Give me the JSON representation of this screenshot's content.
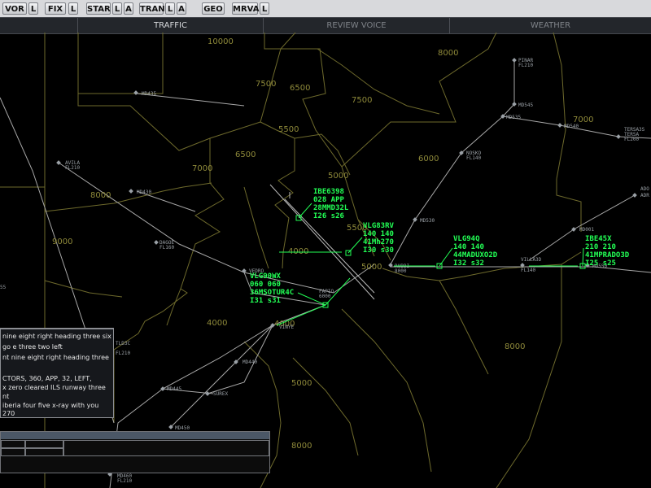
{
  "toolbar": {
    "buttons": [
      {
        "label": "VOR",
        "toggles": [
          "L"
        ]
      },
      {
        "label": "FIX",
        "toggles": [
          "L"
        ]
      },
      {
        "label": "STAR",
        "toggles": [
          "L",
          "A"
        ]
      },
      {
        "label": "TRAN",
        "toggles": [
          "L",
          "A"
        ]
      },
      {
        "label": "GEO",
        "toggles": []
      },
      {
        "label": "MRVA",
        "toggles": [
          "L"
        ]
      }
    ]
  },
  "tabs": [
    "TRAFFIC",
    "REVIEW VOICE",
    "WEATHER"
  ],
  "active_tab": "TRAFFIC",
  "altitude_labels": [
    "10000",
    "8000",
    "7500",
    "6500",
    "5500",
    "7500",
    "6000",
    "6500",
    "7000",
    "7000",
    "8000",
    "5000",
    "9000",
    "5500",
    "4000",
    "5000",
    "4000",
    "4000",
    "8000",
    "5000",
    "8000"
  ],
  "fixes": [
    {
      "name": "MD435",
      "alt": ""
    },
    {
      "name": "PINAR",
      "alt": "FL210"
    },
    {
      "name": "MD545",
      "alt": ""
    },
    {
      "name": "MD535",
      "alt": ""
    },
    {
      "name": "MD540",
      "alt": ""
    },
    {
      "name": "TERSA3S",
      "alt": ""
    },
    {
      "name": "TERSA",
      "alt": "FL200"
    },
    {
      "name": "AVILA",
      "alt": "FL210"
    },
    {
      "name": "NOSKO",
      "alt": "FL140"
    },
    {
      "name": "MD430",
      "alt": ""
    },
    {
      "name": "MD530",
      "alt": ""
    },
    {
      "name": "ADO",
      "alt": ""
    },
    {
      "name": "ADR",
      "alt": ""
    },
    {
      "name": "DAGOE",
      "alt": "FL160"
    },
    {
      "name": "MD001",
      "alt": ""
    },
    {
      "name": "RUBBI",
      "alt": "8000"
    },
    {
      "name": "VILLA3D",
      "alt": "FL140"
    },
    {
      "name": "MD550",
      "alt": ""
    },
    {
      "name": "VEDRO",
      "alt": ""
    },
    {
      "name": "FAPIO",
      "alt": "6000"
    },
    {
      "name": "VINYE",
      "alt": ""
    },
    {
      "name": "TLD3C",
      "alt": "FL210"
    },
    {
      "name": "MD440",
      "alt": ""
    },
    {
      "name": "MD445",
      "alt": ""
    },
    {
      "name": "SUREX",
      "alt": ""
    },
    {
      "name": "MD450",
      "alt": ""
    },
    {
      "name": "MD460",
      "alt": "FL210"
    },
    {
      "name": "55",
      "alt": ""
    }
  ],
  "aircraft": [
    {
      "callsign": "IBE6398",
      "line2": "028 APP",
      "line3": "28MMD32L",
      "line4": "I26 s26"
    },
    {
      "callsign": "VLG83RV",
      "line2": "140 140",
      "line3": "41Mh270",
      "line4": "I30 s30"
    },
    {
      "callsign": "VLG94Q",
      "line2": "140 140",
      "line3": "44MADUXO2D",
      "line4": "I32 s32"
    },
    {
      "callsign": "IBE45X",
      "line2": "210 210",
      "line3": "41MPRADO3D",
      "line4": "I25 s25"
    },
    {
      "callsign": "VLG90WX",
      "line2": "060 060",
      "line3": "36MSOTUR4C",
      "line4": "I31 s31"
    }
  ],
  "transcript": [
    "nine eight right heading three six",
    "go e three two left",
    "nt nine eight right heading three",
    "",
    "CTORS, 360, APP, 32, LEFT,",
    "x zero cleared ILS runway three",
    "nt",
    "iberia four five x-ray with you",
    "270"
  ],
  "colors": {
    "background": "#000000",
    "traffic": "#22ff55",
    "sector_lines": "#6e6a2c",
    "altitude_text": "#8f8a3a",
    "airways": "#a8a8a8",
    "toolbar": "#d8d9dc"
  }
}
